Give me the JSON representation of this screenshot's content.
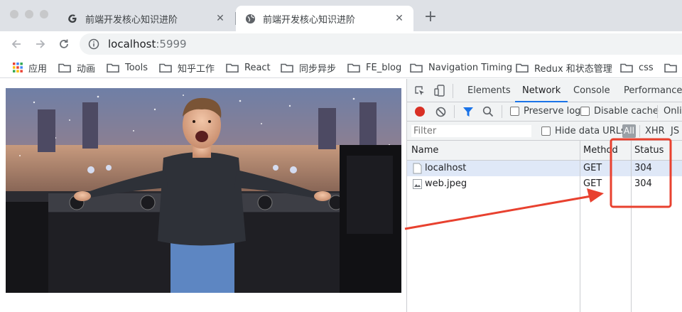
{
  "browser": {
    "tabs": [
      {
        "title": "前端开发核心知识进阶",
        "active": false,
        "favicon": "google-g-icon"
      },
      {
        "title": "前端开发核心知识进阶",
        "active": true,
        "favicon": "globe-icon"
      }
    ],
    "new_tab_label": "+",
    "close_label": "✕",
    "address": {
      "host": "localhost",
      "port": ":5999"
    },
    "bookmarks": [
      {
        "label": "应用",
        "icon": "apps-grid-icon"
      },
      {
        "label": "动画",
        "icon": "folder-icon"
      },
      {
        "label": "Tools",
        "icon": "folder-icon"
      },
      {
        "label": "知乎工作",
        "icon": "folder-icon"
      },
      {
        "label": "React",
        "icon": "folder-icon"
      },
      {
        "label": "同步异步",
        "icon": "folder-icon"
      },
      {
        "label": "FE_blog",
        "icon": "folder-icon"
      },
      {
        "label": "Navigation Timing",
        "icon": "folder-icon"
      },
      {
        "label": "Redux 和状态管理",
        "icon": "folder-icon"
      },
      {
        "label": "css",
        "icon": "folder-icon"
      },
      {
        "label": "",
        "icon": "folder-icon"
      }
    ]
  },
  "devtools": {
    "tabs": [
      "Elements",
      "Network",
      "Console",
      "Performance"
    ],
    "selected_tab": "Network",
    "toolbar": {
      "preserve_log": "Preserve log",
      "disable_cache": "Disable cache",
      "online": "Onlin"
    },
    "filter_bar": {
      "filter_placeholder": "Filter",
      "hide_data_urls": "Hide data URLs",
      "all": "All",
      "xhr": "XHR",
      "js": "JS"
    },
    "columns": [
      "Name",
      "Method",
      "Status"
    ],
    "rows": [
      {
        "name": "localhost",
        "method": "GET",
        "status": "304",
        "icon": "document-icon"
      },
      {
        "name": "web.jpeg",
        "method": "GET",
        "status": "304",
        "icon": "image-file-icon"
      }
    ]
  },
  "colors": {
    "record": "#d93025",
    "accent": "#1a73e8",
    "annotation": "#e8412f"
  }
}
